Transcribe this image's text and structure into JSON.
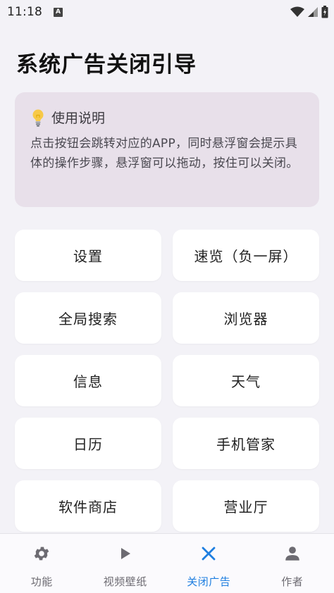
{
  "status": {
    "time": "11:18",
    "notif_badge": "A"
  },
  "header": {
    "title": "系统广告关闭引导"
  },
  "info": {
    "icon": "lightbulb-icon",
    "title": "使用说明",
    "body": "点击按钮会跳转对应的APP，同时悬浮窗会提示具体的操作步骤，悬浮窗可以拖动，按住可以关闭。"
  },
  "tiles": [
    {
      "label": "设置"
    },
    {
      "label": "速览（负一屏）"
    },
    {
      "label": "全局搜索"
    },
    {
      "label": "浏览器"
    },
    {
      "label": "信息"
    },
    {
      "label": "天气"
    },
    {
      "label": "日历"
    },
    {
      "label": "手机管家"
    },
    {
      "label": "软件商店"
    },
    {
      "label": "营业厅"
    }
  ],
  "nav": {
    "items": [
      {
        "label": "功能",
        "icon": "gear-icon"
      },
      {
        "label": "视频壁纸",
        "icon": "play-icon"
      },
      {
        "label": "关闭广告",
        "icon": "close-icon"
      },
      {
        "label": "作者",
        "icon": "person-icon"
      }
    ],
    "active_index": 2,
    "accent_color": "#1e7ee0"
  }
}
